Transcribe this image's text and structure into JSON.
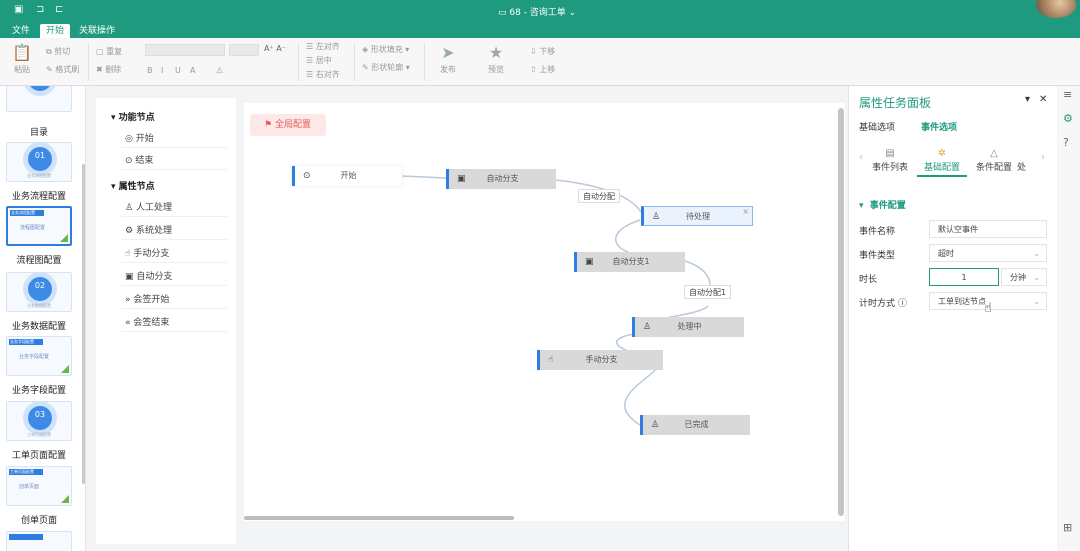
{
  "window": {
    "title": "68 - 咨询工单",
    "title_icon": "monitor-icon"
  },
  "menu": {
    "file": "文件",
    "home": "开始",
    "related": "关联操作"
  },
  "ribbon": {
    "paste": "粘贴",
    "cut": "剪切",
    "format_painter": "格式刷",
    "redo": "重复",
    "delete": "删除",
    "bold": "B",
    "italic": "I",
    "underline": "U",
    "align_left": "左对齐",
    "align_center": "居中",
    "align_right": "右对齐",
    "shape_fill": "形状填充",
    "shape_outline": "形状轮廓",
    "publish": "发布",
    "preview": "预览",
    "move_down": "下移",
    "move_up": "上移"
  },
  "left_panel": {
    "items": [
      {
        "label": "目录"
      },
      {
        "label": "业务流程配置",
        "badge": "01",
        "caption": "业务流程配置"
      },
      {
        "label": "流程图配置",
        "header": "业务流程配置",
        "mini": "流程图配置"
      },
      {
        "label": "业务数据配置",
        "badge": "02",
        "caption": "业务数据配置"
      },
      {
        "label": "业务字段配置",
        "header": "业务字段配置",
        "mini": "业务字段配置"
      },
      {
        "label": "工单页面配置",
        "badge": "03",
        "caption": "工单页面配置"
      },
      {
        "label": "创单页面",
        "header": "工单页面配置",
        "mini": "创单页面"
      }
    ]
  },
  "node_panel": {
    "functional_group": "功能节点",
    "functional_items": [
      "开始",
      "结束"
    ],
    "attribute_group": "属性节点",
    "attribute_items": [
      "人工处理",
      "系统处理",
      "手动分支",
      "自动分支",
      "会签开始",
      "会签结束"
    ]
  },
  "canvas": {
    "global_config": "全局配置",
    "nodes": {
      "start": "开始",
      "auto_branch": "自动分支",
      "pending": "待处理",
      "auto_branch1": "自动分支1",
      "processing": "处理中",
      "manual_branch": "手动分支",
      "done": "已完成"
    },
    "edge_labels": {
      "auto_dist": "自动分配",
      "auto_dist1": "自动分配1"
    }
  },
  "right_panel": {
    "title": "属性任务面板",
    "tabs": {
      "basic": "基础选项",
      "event": "事件选项"
    },
    "subtabs": {
      "event_list": "事件列表",
      "basic_config": "基础配置",
      "condition_config": "条件配置",
      "more": "处"
    },
    "section": "事件配置",
    "fields": {
      "event_name_label": "事件名称",
      "event_name_value": "默认空事件",
      "event_type_label": "事件类型",
      "event_type_value": "超时",
      "duration_label": "时长",
      "duration_value": "1",
      "duration_unit": "分钟",
      "timing_label": "计时方式",
      "timing_value": "工单到达节点"
    }
  },
  "colors": {
    "brand": "#1e9b7f",
    "node_accent": "#2f7de1"
  }
}
